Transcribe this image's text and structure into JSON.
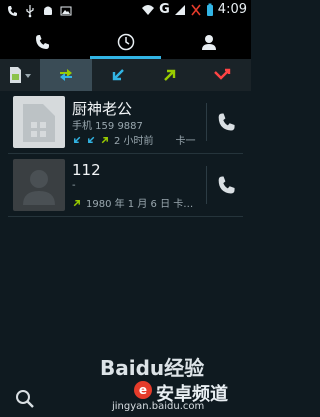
{
  "status_bar": {
    "time": "4:09",
    "network": "G",
    "icons": [
      "missed-call-icon",
      "usb-icon",
      "android-icon",
      "image-icon",
      "wifi-icon",
      "signal-icon",
      "no-signal-icon",
      "battery-icon"
    ]
  },
  "tabs": [
    {
      "name": "phone",
      "icon": "phone-icon",
      "active": false
    },
    {
      "name": "call-log",
      "icon": "clock-icon",
      "active": true
    },
    {
      "name": "contacts",
      "icon": "person-icon",
      "active": false
    }
  ],
  "filters": [
    {
      "icon": "sim-card-icon",
      "selected": false
    },
    {
      "icon": "all-calls-icon",
      "selected": true,
      "color": "#6aa84f"
    },
    {
      "icon": "incoming-call-icon",
      "selected": false,
      "color": "#32b5e5"
    },
    {
      "icon": "outgoing-call-icon",
      "selected": false,
      "color": "#99cc00"
    },
    {
      "icon": "missed-call-icon",
      "selected": false,
      "color": "#ff4444"
    }
  ],
  "calls": [
    {
      "name": "厨神老公",
      "number_line": "手机 159 9887",
      "time_line": "2 小时前",
      "extra": "卡一",
      "icons": [
        "incoming-call-icon",
        "incoming-call-icon",
        "outgoing-call-icon"
      ]
    },
    {
      "name": "112",
      "number_line": "-",
      "time_line": "1980 年 1 月 6 日 卡…",
      "icons": [
        "outgoing-call-icon"
      ]
    }
  ],
  "watermark": {
    "brand": "Baidu经验",
    "domain": "jingyan.baidu.com",
    "overlay_text": "安卓频道",
    "overlay_badge": "e"
  },
  "colors": {
    "accent": "#32b5e5",
    "incoming": "#32b5e5",
    "outgoing": "#99cc00",
    "missed": "#ff4444"
  }
}
